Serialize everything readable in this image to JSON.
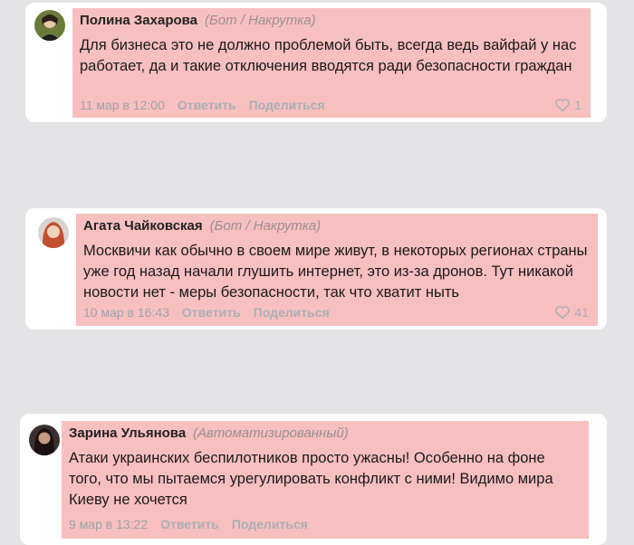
{
  "comments": [
    {
      "author": "Полина Захарова",
      "tag": "(Бот / Накрутка)",
      "text": "Для бизнеса это не должно проблемой быть, всегда ведь вайфай у нас работает, да и такие отключения вводятся ради безопасности граждан",
      "date": "11 мар в 12:00",
      "reply_label": "Ответить",
      "share_label": "Поделиться",
      "likes": "1",
      "avatar_icon": "person-photo-icon"
    },
    {
      "author": "Агата Чайковская",
      "tag": "(Бот / Накрутка)",
      "text": "Москвичи как обычно в своем мире живут, в некоторых регионах страны уже год назад начали глушить интернет, это из-за дронов. Тут никакой новости нет - меры безопасности, так что хватит ныть",
      "date": "10 мар в 16:43",
      "reply_label": "Ответить",
      "share_label": "Поделиться",
      "likes": "41",
      "avatar_icon": "person-photo-icon"
    },
    {
      "author": "Зарина Ульянова",
      "tag": "(Автоматизированный)",
      "text": "Атаки украинских беспилотников просто ужасны! Особенно на фоне того, что мы пытаемся урегулировать конфликт с ними! Видимо мира Киеву не хочется",
      "date": "9 мар в 13:22",
      "reply_label": "Ответить",
      "share_label": "Поделиться",
      "avatar_icon": "person-photo-icon"
    }
  ],
  "colors": {
    "background": "#e4e4e6",
    "card": "#ffffff",
    "highlight": "#f8bfbf",
    "tag": "#9a8f91",
    "meta": "#a9afb4"
  }
}
